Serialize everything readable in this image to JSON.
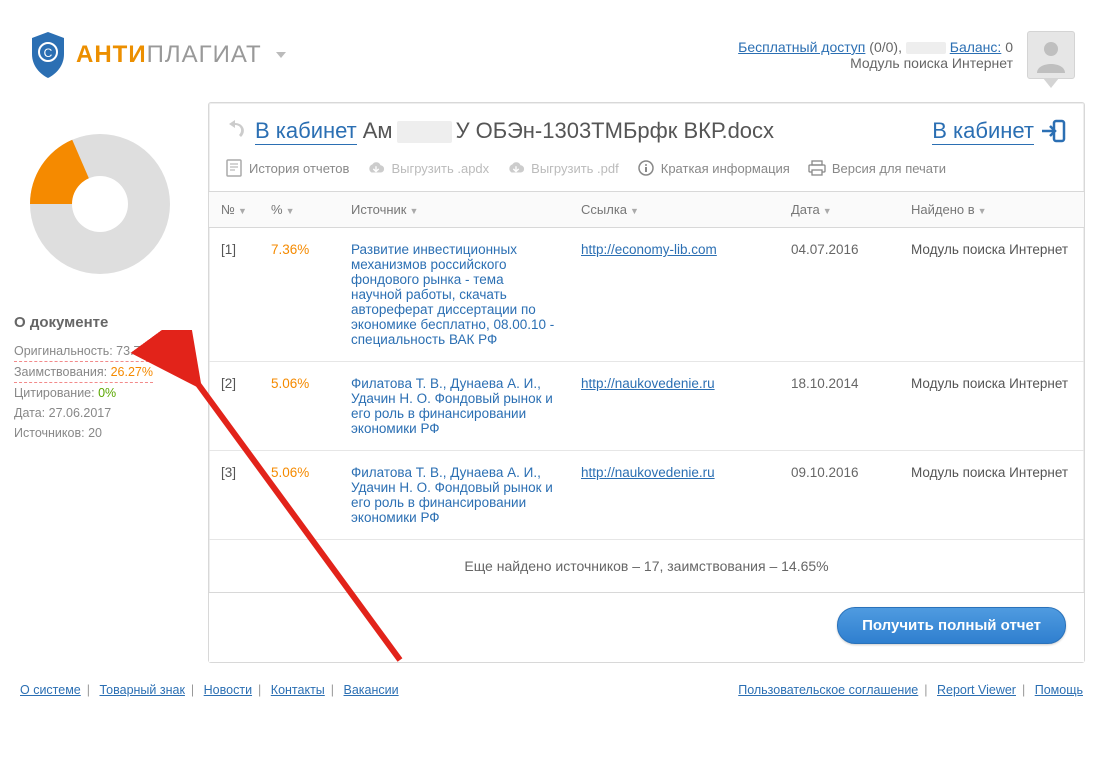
{
  "header": {
    "logo_anti": "АНТИ",
    "logo_plagiat": "ПЛАГИАТ",
    "free_access_label": "Бесплатный доступ",
    "free_access_count": "(0/0),",
    "balance_label": "Баланс:",
    "balance_value": "0",
    "module": "Модуль поиска Интернет"
  },
  "crumb": {
    "back": "В кабинет",
    "title_prefix": "Ам",
    "title_suffix": "У ОБЭн-1303ТМБрфк ВКР.docx",
    "right": "В кабинет"
  },
  "toolbar": {
    "history": "История отчетов",
    "export_apdx": "Выгрузить .apdx",
    "export_pdf": "Выгрузить .pdf",
    "brief": "Краткая информация",
    "print": "Версия для печати"
  },
  "sidebar": {
    "about": "О документе",
    "originality_label": "Оригинальность:",
    "originality_value": "73.73%",
    "borrow_label": "Заимствования:",
    "borrow_value": "26.27%",
    "cite_label": "Цитирование:",
    "cite_value": "0%",
    "date_label": "Дата:",
    "date_value": "27.06.2017",
    "sources_label": "Источников:",
    "sources_value": "20"
  },
  "chart_data": {
    "type": "pie",
    "title": "",
    "series": [
      {
        "name": "Оригинальность",
        "value": 73.73,
        "color": "#dedede"
      },
      {
        "name": "Заимствования",
        "value": 26.27,
        "color": "#f58a00"
      },
      {
        "name": "Цитирование",
        "value": 0,
        "color": "#5aa700"
      }
    ]
  },
  "table": {
    "headers": {
      "num": "№",
      "pct": "%",
      "source": "Источник",
      "link": "Ссылка",
      "date": "Дата",
      "found": "Найдено в"
    },
    "rows": [
      {
        "num": "[1]",
        "pct": "7.36%",
        "source": "Развитие инвестиционных механизмов российского фондового рынка - тема научной работы, скачать автореферат диссертации по экономике бесплатно, 08.00.10 - специальность ВАК РФ",
        "link": "http://economy-lib.com",
        "date": "04.07.2016",
        "found": "Модуль поиска Интернет"
      },
      {
        "num": "[2]",
        "pct": "5.06%",
        "source": "Филатова Т. В., Дунаева А. И., Удачин Н. О. Фондовый рынок и его роль в финансировании экономики РФ",
        "link": "http://naukovedenie.ru",
        "date": "18.10.2014",
        "found": "Модуль поиска Интернет"
      },
      {
        "num": "[3]",
        "pct": "5.06%",
        "source": "Филатова Т. В., Дунаева А. И., Удачин Н. О. Фондовый рынок и его роль в финансировании экономики РФ",
        "link": "http://naukovedenie.ru",
        "date": "09.10.2016",
        "found": "Модуль поиска Интернет"
      }
    ],
    "more": "Еще найдено источников – 17, заимствования – 14.65%"
  },
  "action": {
    "full_report": "Получить полный отчет"
  },
  "footer": {
    "left": [
      "О системе",
      "Товарный знак",
      "Новости",
      "Контакты",
      "Вакансии"
    ],
    "right": [
      "Пользовательское соглашение",
      "Report Viewer",
      "Помощь"
    ]
  }
}
